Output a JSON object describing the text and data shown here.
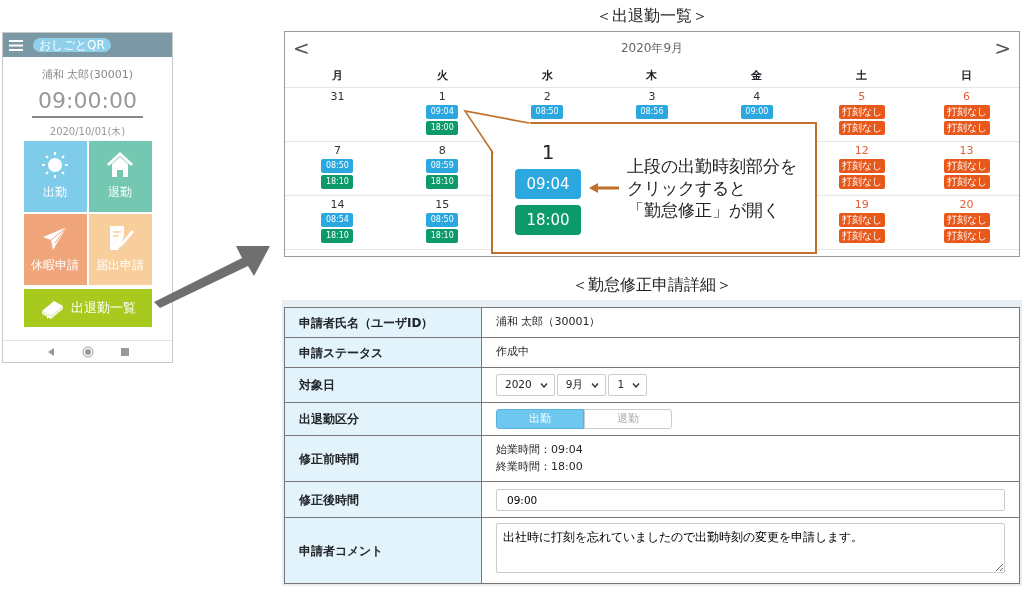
{
  "phone": {
    "app_logo": "おしごとQR",
    "user": "浦和 太郎(30001)",
    "clock": "09:00:00",
    "date": "2020/10/01(木)",
    "tiles": [
      {
        "label": "出勤",
        "kind": "clock-in"
      },
      {
        "label": "退勤",
        "kind": "clock-out"
      },
      {
        "label": "休暇申請",
        "kind": "leave"
      },
      {
        "label": "届出申請",
        "kind": "notice"
      }
    ],
    "list_button": "出退勤一覧"
  },
  "calendar": {
    "title": "＜出退勤一覧＞",
    "prev": "<",
    "next": ">",
    "month": "2020年9月",
    "weekdays": [
      "月",
      "火",
      "水",
      "木",
      "金",
      "土",
      "日"
    ],
    "weeks": [
      {
        "left": [
          {
            "day": "31",
            "holiday": false
          },
          {
            "day": "1",
            "holiday": false,
            "stamps": [
              {
                "text": "09:04",
                "kind": "in"
              },
              {
                "text": "18:00",
                "kind": "out"
              }
            ]
          }
        ],
        "middle": [
          {
            "day": "2",
            "holiday": false,
            "stamps": [
              {
                "text": "08:50",
                "kind": "in"
              }
            ]
          },
          {
            "day": "3",
            "holiday": false,
            "stamps": [
              {
                "text": "08:56",
                "kind": "in"
              }
            ]
          },
          {
            "day": "4",
            "holiday": false,
            "stamps": [
              {
                "text": "09:00",
                "kind": "in"
              }
            ]
          }
        ],
        "right": [
          {
            "day": "5",
            "holiday": true,
            "stamps": [
              {
                "text": "打刻なし",
                "kind": "none"
              },
              {
                "text": "打刻なし",
                "kind": "none"
              }
            ]
          },
          {
            "day": "6",
            "holiday": true,
            "stamps": [
              {
                "text": "打刻なし",
                "kind": "none"
              },
              {
                "text": "打刻なし",
                "kind": "none"
              }
            ]
          }
        ]
      },
      {
        "left": [
          {
            "day": "7",
            "holiday": false,
            "stamps": [
              {
                "text": "08:50",
                "kind": "in"
              },
              {
                "text": "18:10",
                "kind": "out"
              }
            ]
          },
          {
            "day": "8",
            "holiday": false,
            "stamps": [
              {
                "text": "08:59",
                "kind": "in"
              },
              {
                "text": "18:10",
                "kind": "out"
              }
            ]
          }
        ],
        "right": [
          {
            "day": "12",
            "holiday": true,
            "stamps": [
              {
                "text": "打刻なし",
                "kind": "none"
              },
              {
                "text": "打刻なし",
                "kind": "none"
              }
            ]
          },
          {
            "day": "13",
            "holiday": true,
            "stamps": [
              {
                "text": "打刻なし",
                "kind": "none"
              },
              {
                "text": "打刻なし",
                "kind": "none"
              }
            ]
          }
        ]
      },
      {
        "left": [
          {
            "day": "14",
            "holiday": false,
            "stamps": [
              {
                "text": "08:54",
                "kind": "in"
              },
              {
                "text": "18:10",
                "kind": "out"
              }
            ]
          },
          {
            "day": "15",
            "holiday": false,
            "stamps": [
              {
                "text": "08:50",
                "kind": "in"
              },
              {
                "text": "18:10",
                "kind": "out"
              }
            ]
          }
        ],
        "right": [
          {
            "day": "19",
            "holiday": true,
            "stamps": [
              {
                "text": "打刻なし",
                "kind": "none"
              },
              {
                "text": "打刻なし",
                "kind": "none"
              }
            ]
          },
          {
            "day": "20",
            "holiday": true,
            "stamps": [
              {
                "text": "打刻なし",
                "kind": "none"
              },
              {
                "text": "打刻なし",
                "kind": "none"
              }
            ]
          }
        ]
      }
    ]
  },
  "callout": {
    "day": "1",
    "stamps": [
      {
        "text": "09:04",
        "kind": "in"
      },
      {
        "text": "18:00",
        "kind": "out"
      }
    ],
    "lines": [
      "上段の出勤時刻部分を",
      "クリックすると",
      "「勤怠修正」が開く"
    ]
  },
  "form": {
    "title": "＜勤怠修正申請詳細＞",
    "rows": [
      {
        "label": "申請者氏名（ユーザID）",
        "kind": "text",
        "value": "浦和 太郎（30001）"
      },
      {
        "label": "申請ステータス",
        "kind": "text",
        "value": "作成中"
      },
      {
        "label": "対象日",
        "kind": "selects",
        "values": [
          "2020",
          "9月",
          "1"
        ]
      },
      {
        "label": "出退勤区分",
        "kind": "toggle",
        "options": [
          {
            "label": "出勤",
            "selected": true
          },
          {
            "label": "退勤",
            "selected": false
          }
        ]
      },
      {
        "label": "修正前時間",
        "kind": "lines",
        "lines": [
          "始業時間：09:04",
          "終業時間：18:00"
        ]
      },
      {
        "label": "修正後時間",
        "kind": "input",
        "value": "09:00"
      },
      {
        "label": "申請者コメント",
        "kind": "textarea",
        "value": "出社時に打刻を忘れていましたので出勤時刻の変更を申請します。"
      }
    ]
  }
}
